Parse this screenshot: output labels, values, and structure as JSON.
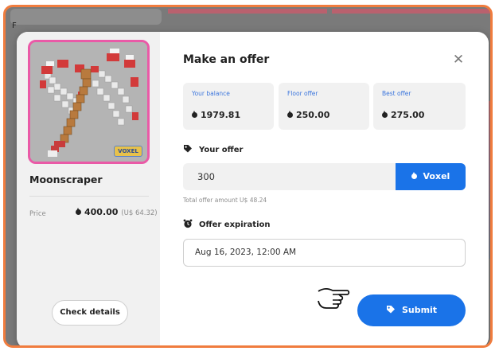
{
  "background": {
    "corner_text": "F"
  },
  "nft": {
    "name": "Moonscraper",
    "badge_text": "VOXEL",
    "price_label": "Price",
    "price_value": "400.00",
    "price_usd": "(U$ 64.32)",
    "check_details_label": "Check details"
  },
  "modal": {
    "title": "Make an offer",
    "close_icon": "close-icon",
    "stats": [
      {
        "label": "Your balance",
        "value": "1979.81"
      },
      {
        "label": "Floor offer",
        "value": "250.00"
      },
      {
        "label": "Best offer",
        "value": "275.00"
      }
    ],
    "your_offer_label": "Your offer",
    "offer_value": "300",
    "currency_button_label": "Voxel",
    "total_text": "Total offer amount U$ 48.24",
    "expiration_label": "Offer expiration",
    "expiration_value": "Aug 16, 2023, 12:00 AM",
    "submit_label": "Submit"
  },
  "colors": {
    "accent_blue": "#1a73e8",
    "frame_orange": "#f07c3e",
    "nft_border_pink": "#ea5aa7",
    "label_blue": "#3c76dd"
  },
  "icons": [
    "voxel-drop-icon",
    "tag-icon",
    "alarm-clock-icon",
    "close-icon",
    "pointing-hand-icon"
  ]
}
